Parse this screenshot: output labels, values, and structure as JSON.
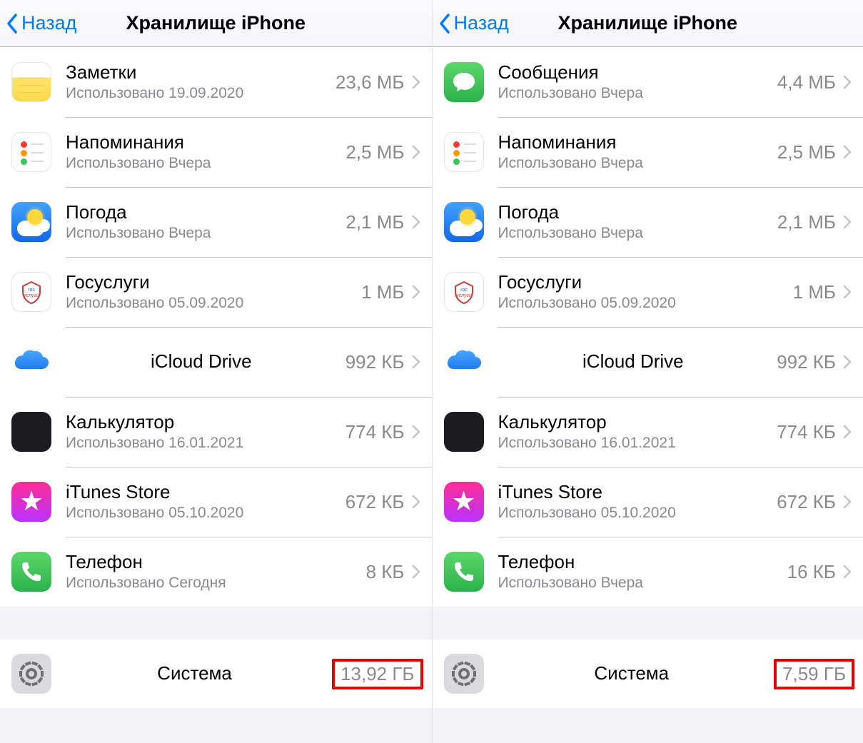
{
  "nav": {
    "back": "Назад",
    "title": "Хранилище iPhone"
  },
  "icons": {
    "notes": "notes-icon",
    "reminders": "reminders-icon",
    "weather": "weather-icon",
    "gos": "gosuslugi-icon",
    "icloud": "icloud-icon",
    "calc": "calculator-icon",
    "itunes": "itunes-store-icon",
    "phone": "phone-icon",
    "messages": "messages-icon",
    "system": "settings-gear-icon"
  },
  "screens": [
    {
      "id": "left",
      "items": [
        {
          "icon": "notes",
          "name": "Заметки",
          "sub": "Использовано 19.09.2020",
          "size": "23,6 МБ"
        },
        {
          "icon": "reminders",
          "name": "Напоминания",
          "sub": "Использовано Вчера",
          "size": "2,5 МБ"
        },
        {
          "icon": "weather",
          "name": "Погода",
          "sub": "Использовано Вчера",
          "size": "2,1 МБ"
        },
        {
          "icon": "gos",
          "name": "Госуслуги",
          "sub": "Использовано 05.09.2020",
          "size": "1 МБ"
        },
        {
          "icon": "icloud",
          "name": "iCloud Drive",
          "sub": "",
          "size": "992 КБ"
        },
        {
          "icon": "calc",
          "name": "Калькулятор",
          "sub": "Использовано 16.01.2021",
          "size": "774 КБ"
        },
        {
          "icon": "itunes",
          "name": "iTunes Store",
          "sub": "Использовано 05.10.2020",
          "size": "672 КБ"
        },
        {
          "icon": "phone",
          "name": "Телефон",
          "sub": "Использовано Сегодня",
          "size": "8 КБ"
        }
      ],
      "system": {
        "name": "Система",
        "size": "13,92 ГБ",
        "highlight": true
      }
    },
    {
      "id": "right",
      "items": [
        {
          "icon": "messages",
          "name": "Сообщения",
          "sub": "Использовано Вчера",
          "size": "4,4 МБ"
        },
        {
          "icon": "reminders",
          "name": "Напоминания",
          "sub": "Использовано Вчера",
          "size": "2,5 МБ"
        },
        {
          "icon": "weather",
          "name": "Погода",
          "sub": "Использовано Вчера",
          "size": "2,1 МБ"
        },
        {
          "icon": "gos",
          "name": "Госуслуги",
          "sub": "Использовано 05.09.2020",
          "size": "1 МБ"
        },
        {
          "icon": "icloud",
          "name": "iCloud Drive",
          "sub": "",
          "size": "992 КБ"
        },
        {
          "icon": "calc",
          "name": "Калькулятор",
          "sub": "Использовано 16.01.2021",
          "size": "774 КБ"
        },
        {
          "icon": "itunes",
          "name": "iTunes Store",
          "sub": "Использовано 05.10.2020",
          "size": "672 КБ"
        },
        {
          "icon": "phone",
          "name": "Телефон",
          "sub": "Использовано Вчера",
          "size": "16 КБ"
        }
      ],
      "system": {
        "name": "Система",
        "size": "7,59 ГБ",
        "highlight": true
      }
    }
  ]
}
